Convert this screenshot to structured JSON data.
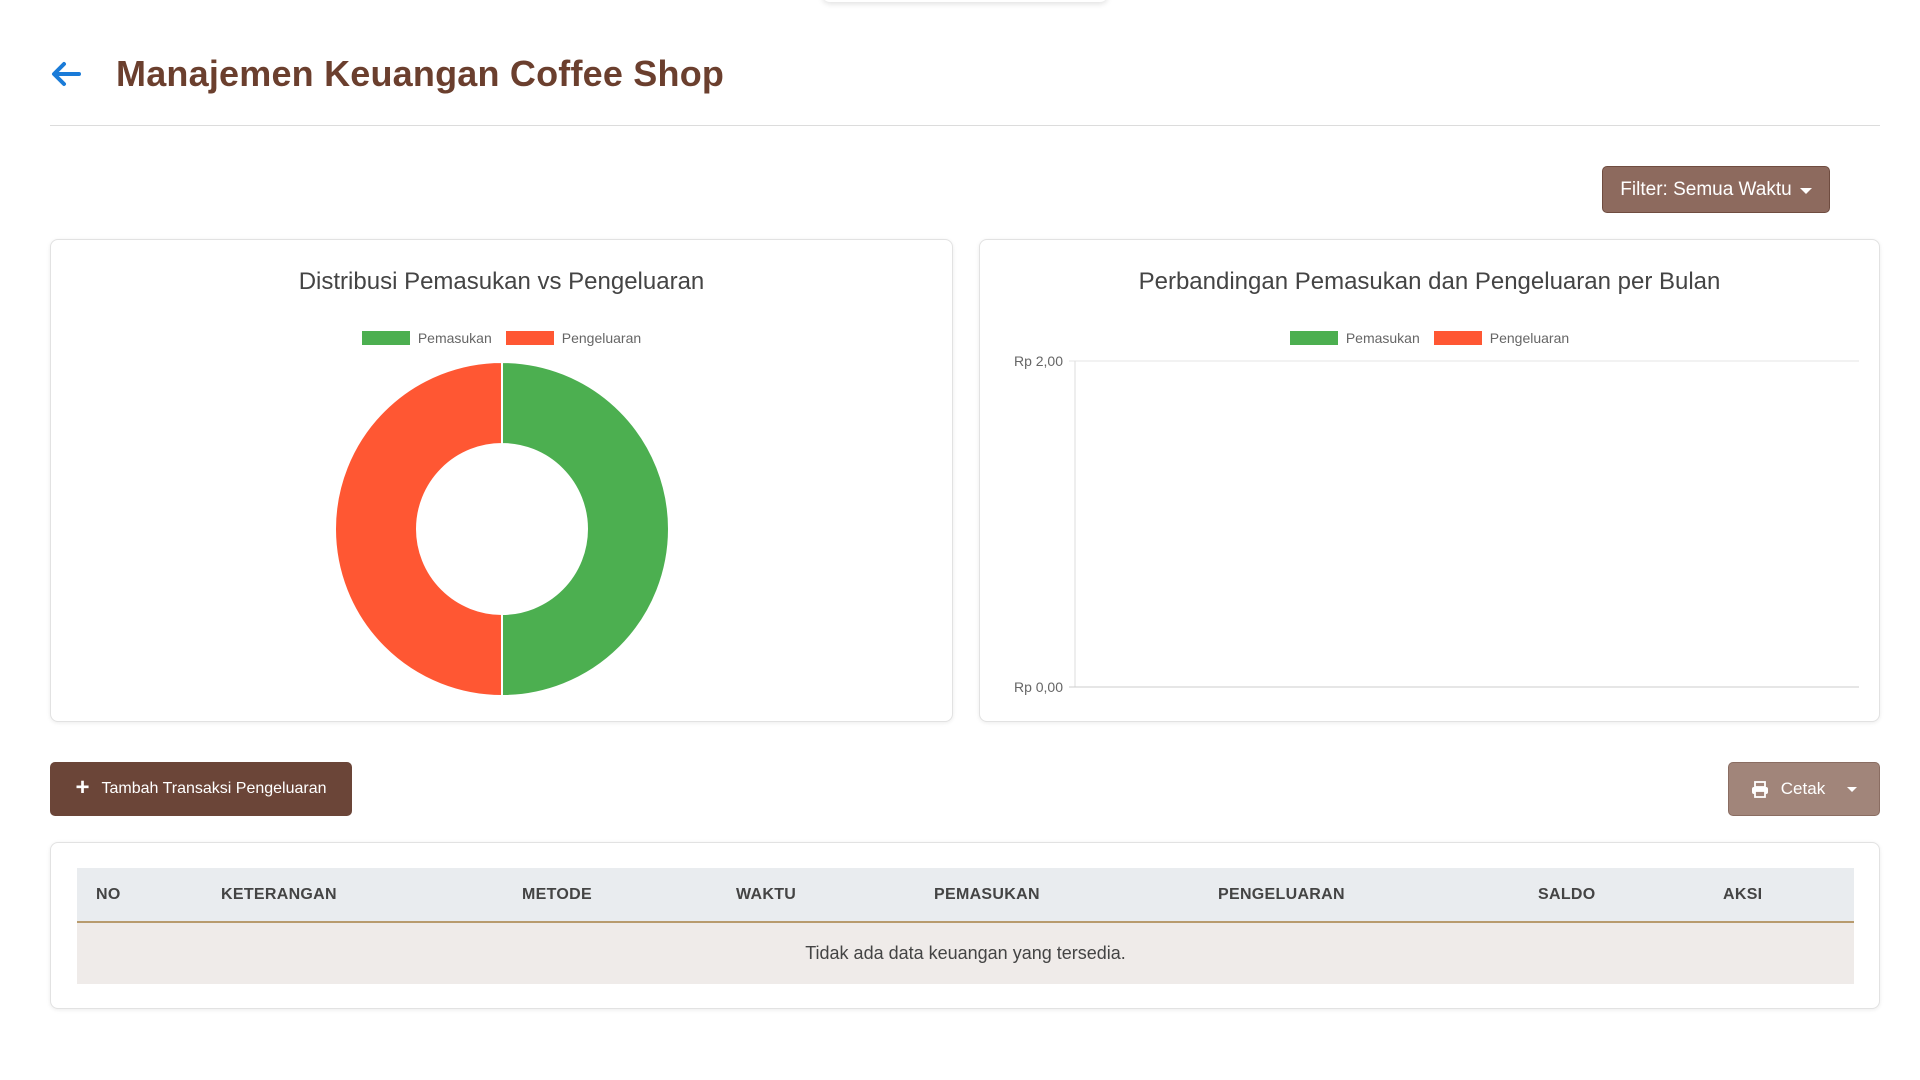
{
  "header": {
    "title": "Manajemen Keuangan Coffee Shop",
    "back_icon": "arrow-left-icon",
    "back_color": "#1a7bd8"
  },
  "filter": {
    "label": "Filter: Semua Waktu"
  },
  "charts": {
    "distribution_title": "Distribusi Pemasukan vs Pengeluaran",
    "monthly_title": "Perbandingan Pemasukan dan Pengeluaran per Bulan"
  },
  "chart_data": [
    {
      "type": "pie",
      "title": "Distribusi Pemasukan vs Pengeluaran",
      "legend_position": "top",
      "categories": [
        "Pemasukan",
        "Pengeluaran"
      ],
      "values": [
        1,
        1
      ],
      "colors": [
        "#4caf50",
        "#ff5733"
      ]
    },
    {
      "type": "bar",
      "title": "Perbandingan Pemasukan dan Pengeluaran per Bulan",
      "legend_position": "top",
      "series": [
        {
          "name": "Pemasukan",
          "values": [],
          "color": "#4caf50"
        },
        {
          "name": "Pengeluaran",
          "values": [],
          "color": "#ff5733"
        }
      ],
      "categories": [],
      "ylim": [
        0,
        2
      ],
      "y_ticks": [
        "Rp 2,00",
        "Rp 0,00"
      ]
    }
  ],
  "actions": {
    "add_label": "Tambah Transaksi Pengeluaran",
    "print_label": "Cetak",
    "print_icon": "printer-icon"
  },
  "table": {
    "columns": [
      "NO",
      "KETERANGAN",
      "METODE",
      "WAKTU",
      "PEMASUKAN",
      "PENGELUARAN",
      "SALDO",
      "AKSI"
    ],
    "empty_message": "Tidak ada data keuangan yang tersedia."
  },
  "colors": {
    "brand": "#6b3f2e",
    "income": "#4caf50",
    "expense": "#ff5733"
  }
}
